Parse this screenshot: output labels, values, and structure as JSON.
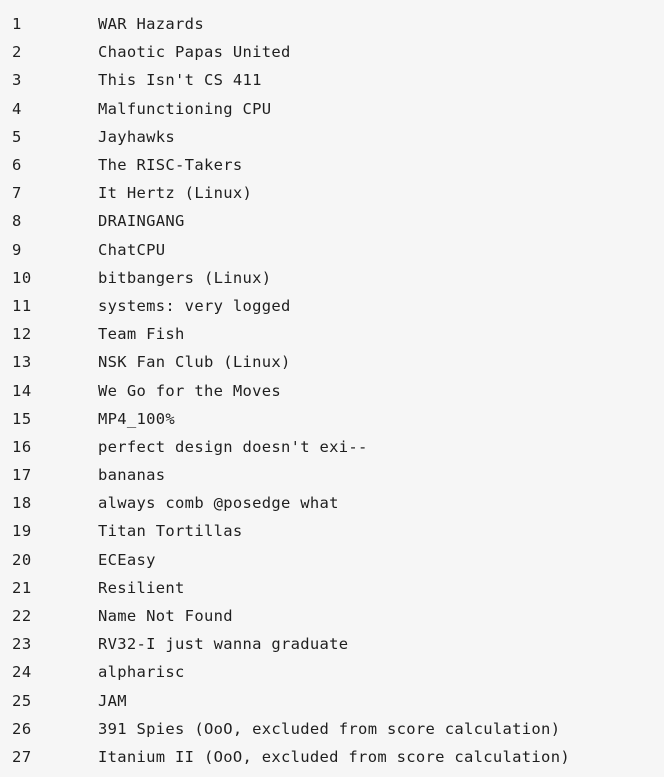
{
  "rows": [
    {
      "rank": "1",
      "team": "WAR Hazards"
    },
    {
      "rank": "2",
      "team": "Chaotic Papas United"
    },
    {
      "rank": "3",
      "team": "This Isn't CS 411"
    },
    {
      "rank": "4",
      "team": "Malfunctioning CPU"
    },
    {
      "rank": "5",
      "team": "Jayhawks"
    },
    {
      "rank": "6",
      "team": "The RISC-Takers"
    },
    {
      "rank": "7",
      "team": "It Hertz (Linux)"
    },
    {
      "rank": "8",
      "team": "DRAINGANG"
    },
    {
      "rank": "9",
      "team": "ChatCPU"
    },
    {
      "rank": "10",
      "team": "bitbangers (Linux)"
    },
    {
      "rank": "11",
      "team": "systems: very logged"
    },
    {
      "rank": "12",
      "team": "Team Fish"
    },
    {
      "rank": "13",
      "team": "NSK Fan Club (Linux)"
    },
    {
      "rank": "14",
      "team": "We Go for the Moves"
    },
    {
      "rank": "15",
      "team": "MP4_100%"
    },
    {
      "rank": "16",
      "team": "perfect design doesn't exi--"
    },
    {
      "rank": "17",
      "team": "bananas"
    },
    {
      "rank": "18",
      "team": "always comb @posedge what"
    },
    {
      "rank": "19",
      "team": "Titan Tortillas"
    },
    {
      "rank": "20",
      "team": "ECEasy"
    },
    {
      "rank": "21",
      "team": "Resilient"
    },
    {
      "rank": "22",
      "team": "Name Not Found"
    },
    {
      "rank": "23",
      "team": "RV32-I just wanna graduate"
    },
    {
      "rank": "24",
      "team": "alpharisc"
    },
    {
      "rank": "25",
      "team": "JAM"
    },
    {
      "rank": "26",
      "team": "391 Spies (OoO, excluded from score calculation)"
    },
    {
      "rank": "27",
      "team": "Itanium II (OoO, excluded from score calculation)"
    }
  ]
}
